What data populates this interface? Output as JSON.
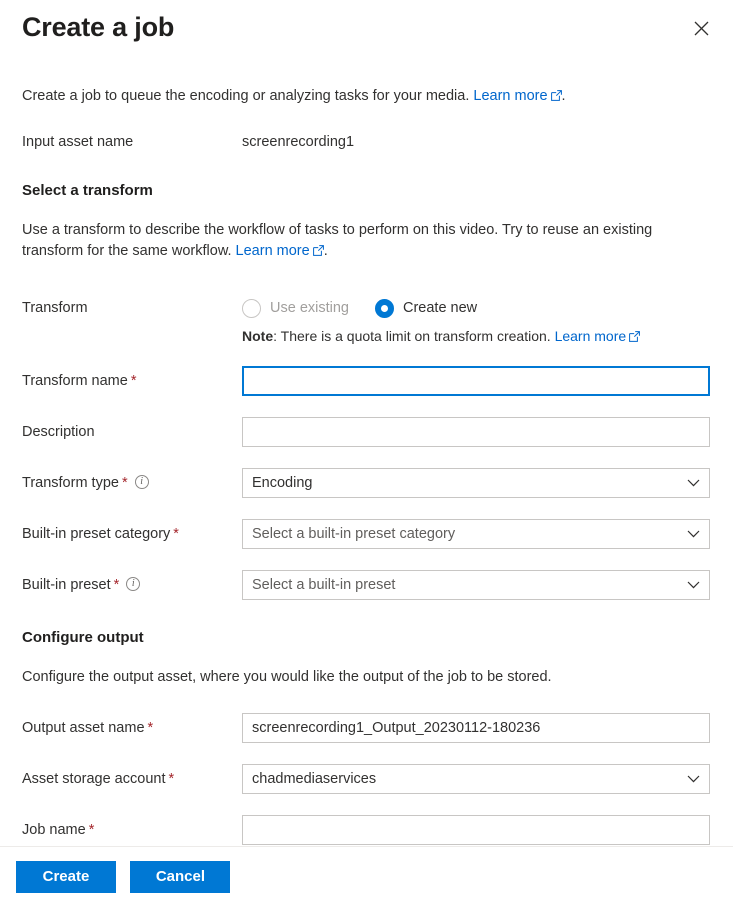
{
  "header": {
    "title": "Create a job",
    "close_icon": "close-icon"
  },
  "intro": {
    "text_before": "Create a job to queue the encoding or analyzing tasks for your media.",
    "link_label": "Learn more",
    "text_after": "."
  },
  "input_asset": {
    "label": "Input asset name",
    "value": "screenrecording1"
  },
  "select_transform": {
    "heading": "Select a transform",
    "description_before": "Use a transform to describe the workflow of tasks to perform on this video. Try to reuse an existing transform for the same workflow.",
    "description_link": "Learn more",
    "description_after": ".",
    "transform_label": "Transform",
    "options": [
      {
        "label": "Use existing",
        "checked": false,
        "disabled": true
      },
      {
        "label": "Create new",
        "checked": true,
        "disabled": false
      }
    ],
    "note_bold": "Note",
    "note_text": ": There is a quota limit on transform creation.",
    "note_link": "Learn more",
    "fields": {
      "transform_name_label": "Transform name",
      "transform_name_value": "",
      "transform_name_placeholder": "",
      "description_label": "Description",
      "description_value": "",
      "description_placeholder": "",
      "transform_type_label": "Transform type",
      "transform_type_value": "Encoding",
      "preset_category_label": "Built-in preset category",
      "preset_category_value": "Select a built-in preset category",
      "preset_label": "Built-in preset",
      "preset_value": "Select a built-in preset"
    }
  },
  "configure_output": {
    "heading": "Configure output",
    "description": "Configure the output asset, where you would like the output of the job to be stored.",
    "output_asset_label": "Output asset name",
    "output_asset_value": "screenrecording1_Output_20230112-180236",
    "storage_account_label": "Asset storage account",
    "storage_account_value": "chadmediaservices",
    "job_name_label": "Job name",
    "job_name_value": ""
  },
  "footer": {
    "create_label": "Create",
    "cancel_label": "Cancel"
  },
  "colors": {
    "accent": "#0078d4",
    "link": "#0066cc",
    "required": "#a4262c",
    "border": "#c8c6c4",
    "text": "#323130",
    "disabled_text": "#a19f9d"
  }
}
